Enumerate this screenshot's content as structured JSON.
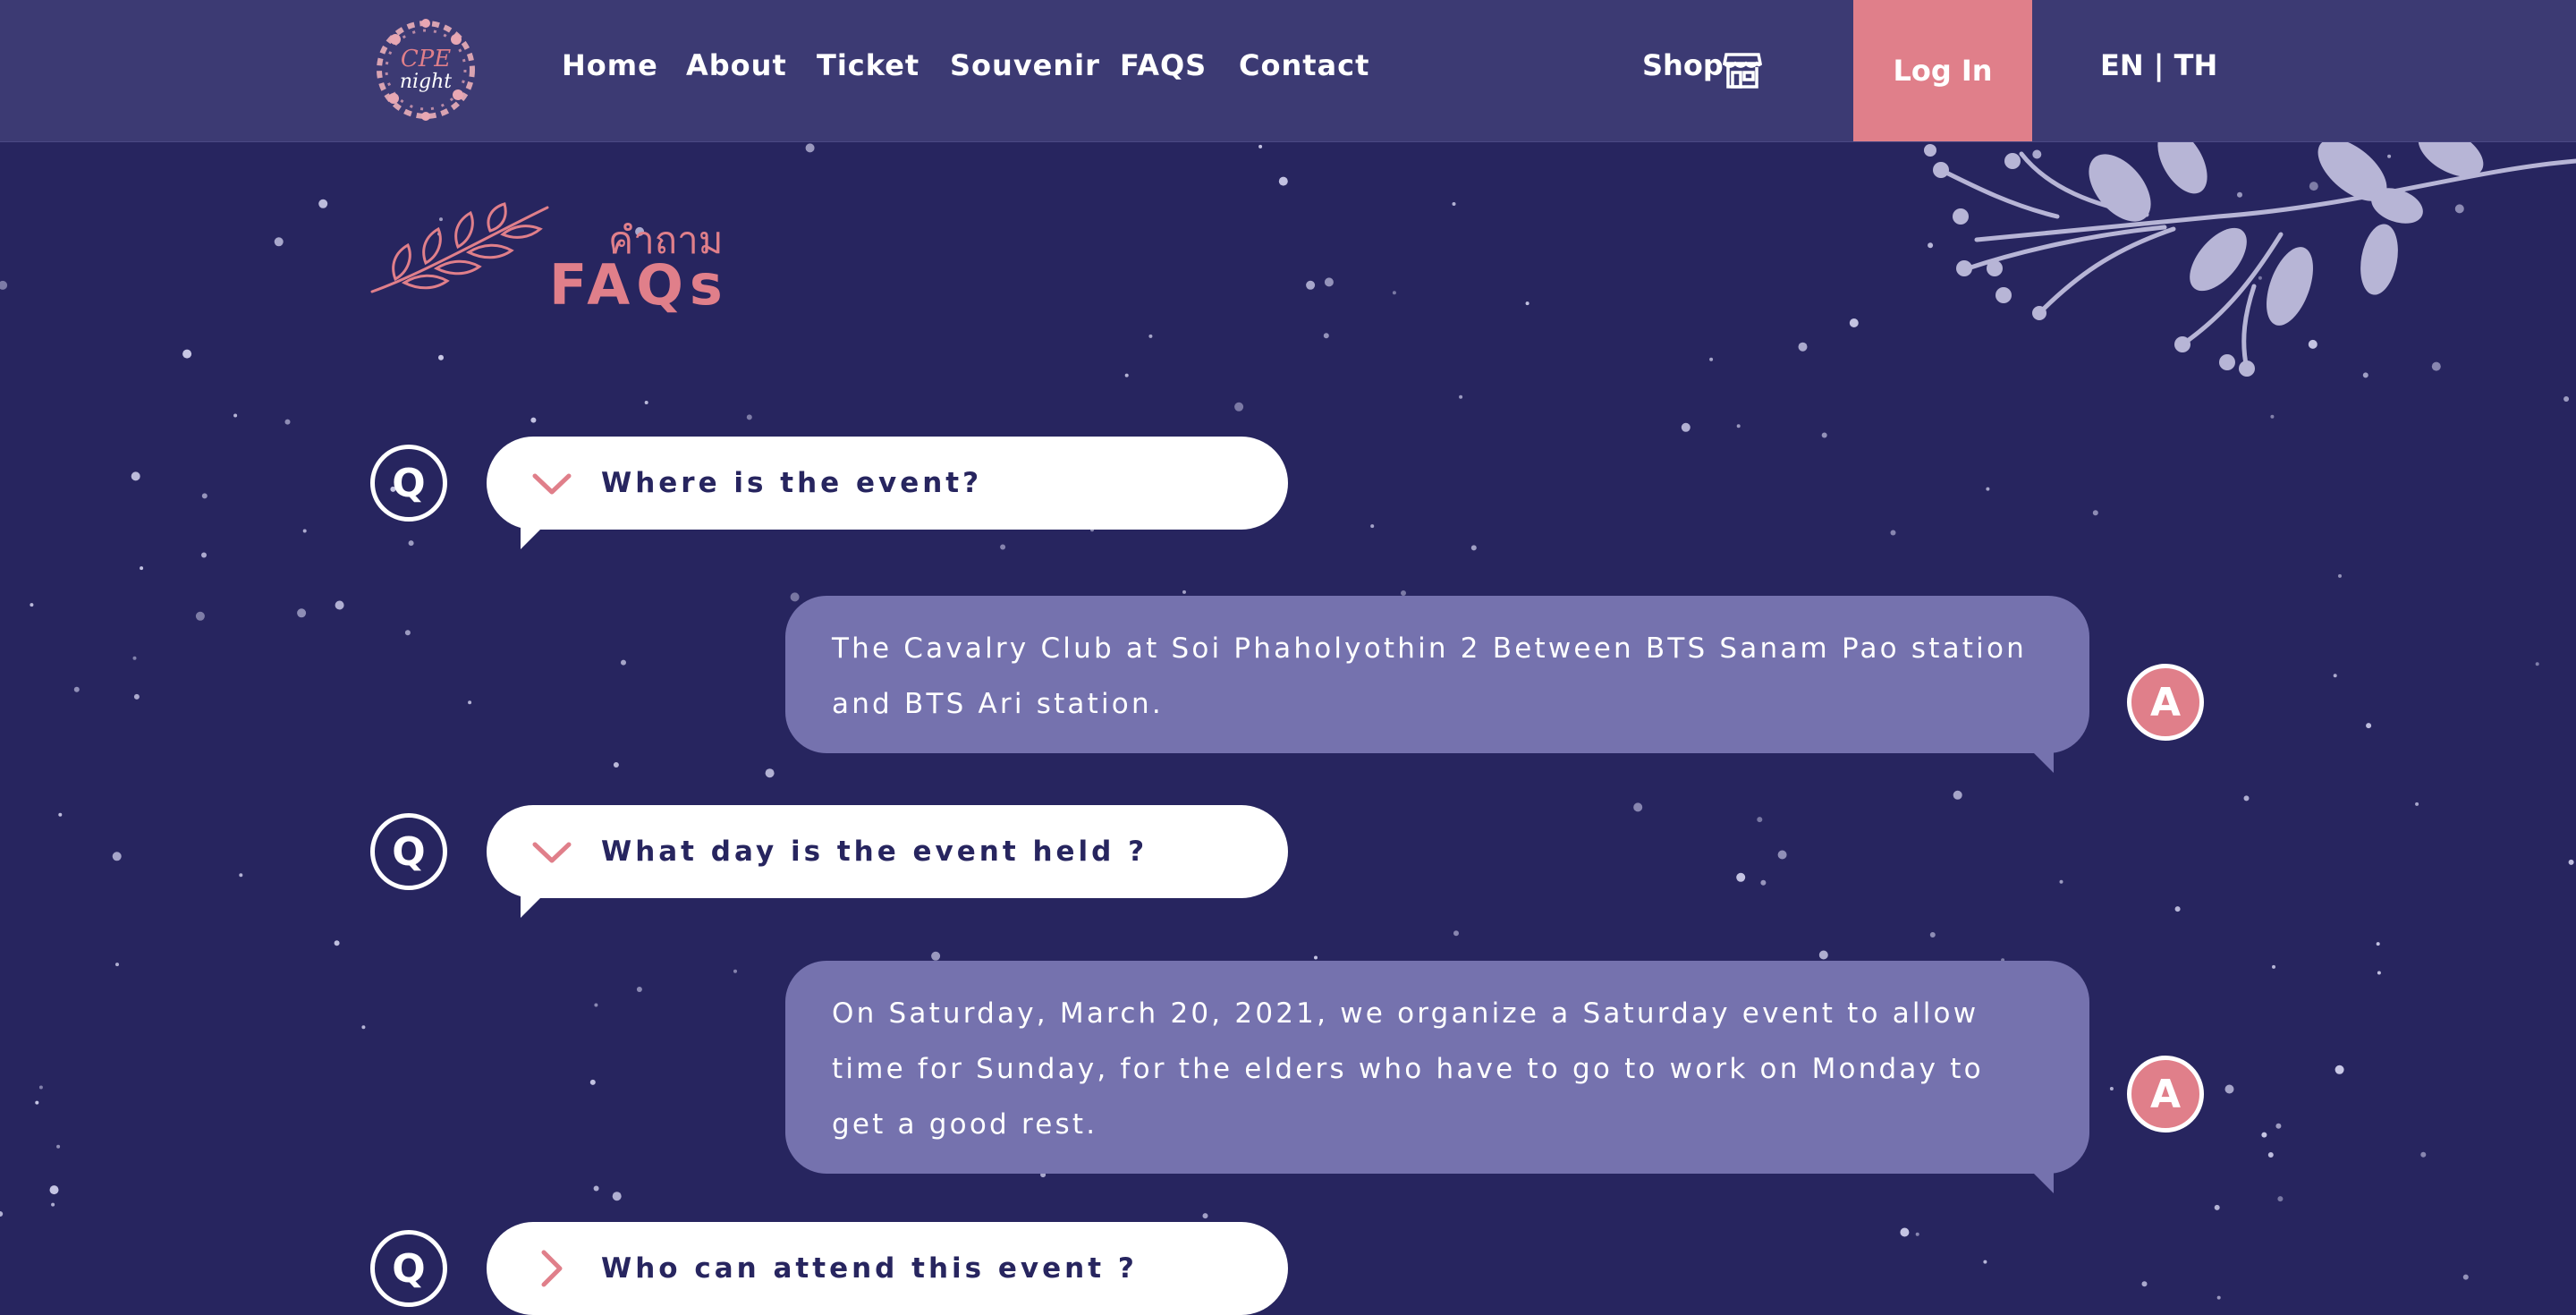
{
  "nav": {
    "logo_text": "CPE night",
    "links": [
      "Home",
      "About",
      "Ticket",
      "Souvenir",
      "FAQS",
      "Contact"
    ],
    "shop_label": "Shop",
    "login_label": "Log In",
    "lang_label": "EN | TH"
  },
  "heading": {
    "subtitle": "คำถาม",
    "title": "FAQs"
  },
  "faq": {
    "q_badge": "Q",
    "a_badge": "A",
    "items": [
      {
        "question": "Where is the event?",
        "answer": "The Cavalry Club at Soi Phaholyothin 2 Between BTS Sanam Pao station and BTS Ari station.",
        "expanded": true
      },
      {
        "question": "What day is the event held ?",
        "answer": "On Saturday, March 20, 2021, we organize a Saturday event to allow time for Sunday, for the elders who have to go to work on Monday to get a good rest.",
        "expanded": true
      },
      {
        "question": "Who can attend this event ?",
        "expanded": false
      }
    ]
  },
  "colors": {
    "background": "#27255f",
    "navbar": "#3c3a73",
    "accent_pink": "#e07f8a",
    "answer_bubble": "#7572ae"
  },
  "icons": {
    "shop": "storefront-icon",
    "expanded": "chevron-down-icon",
    "collapsed": "chevron-right-icon"
  }
}
